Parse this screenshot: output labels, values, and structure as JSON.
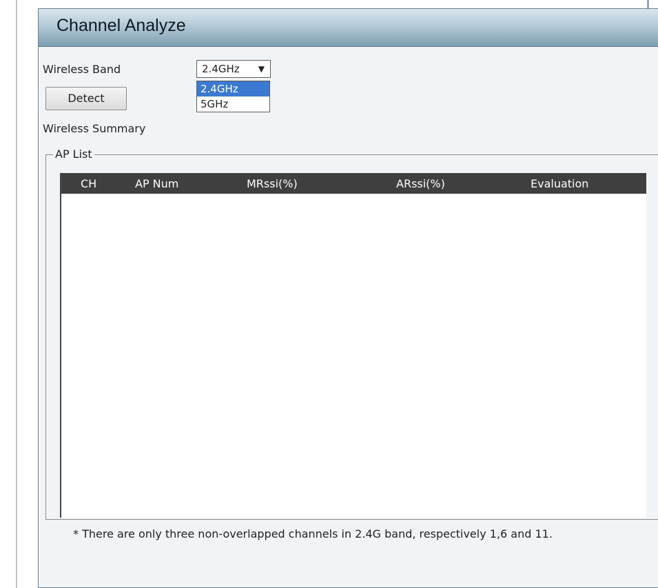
{
  "header": {
    "title": "Channel Analyze"
  },
  "form": {
    "wireless_band_label": "Wireless Band",
    "band_select": {
      "value": "2.4GHz",
      "options": [
        "2.4GHz",
        "5GHz"
      ],
      "highlighted": "2.4GHz"
    },
    "detect_button": "Detect",
    "summary_label": "Wireless Summary"
  },
  "ap_list": {
    "legend": "AP List",
    "columns": [
      "CH",
      "AP Num",
      "MRssi(%)",
      "ARssi(%)",
      "Evaluation"
    ],
    "rows": []
  },
  "footnote": "* There are only three non-overlapped channels in 2.4G band, respectively 1,6 and 11."
}
